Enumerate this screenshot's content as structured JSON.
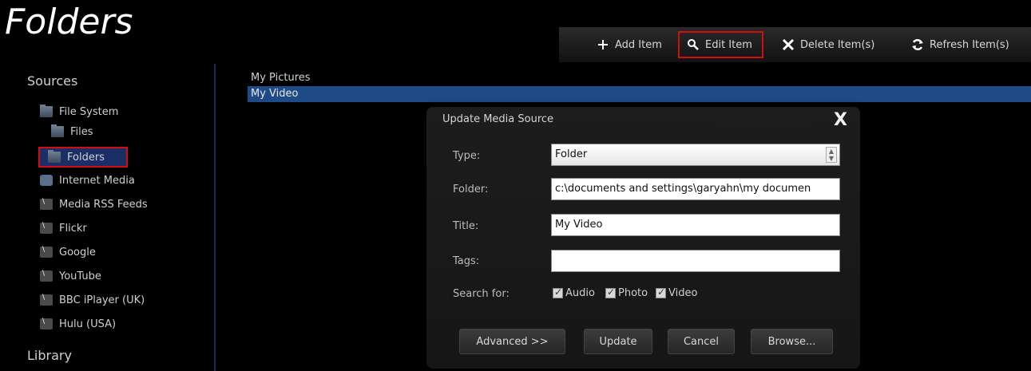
{
  "app": {
    "title": "Folders"
  },
  "toolbar": {
    "add_label": "Add Item",
    "edit_label": "Edit Item",
    "delete_label": "Delete Item(s)",
    "refresh_label": "Refresh Item(s)"
  },
  "sidebar": {
    "sources_heading": "Sources",
    "library_heading": "Library",
    "items": [
      {
        "label": "File System",
        "icon": "folder-icon"
      },
      {
        "label": "Files",
        "icon": "folder-icon"
      },
      {
        "label": "Folders",
        "icon": "folder-icon",
        "selected": true
      },
      {
        "label": "Internet Media",
        "icon": "internet-icon"
      },
      {
        "label": "Media RSS Feeds",
        "icon": "rss-icon"
      },
      {
        "label": "Flickr",
        "icon": "rss-icon"
      },
      {
        "label": "Google",
        "icon": "rss-icon"
      },
      {
        "label": "YouTube",
        "icon": "rss-icon"
      },
      {
        "label": "BBC iPlayer (UK)",
        "icon": "rss-icon"
      },
      {
        "label": "Hulu (USA)",
        "icon": "rss-icon"
      }
    ]
  },
  "list": {
    "rows": [
      {
        "label": "My Pictures"
      },
      {
        "label": "My Video",
        "selected": true
      }
    ]
  },
  "dialog": {
    "title": "Update Media Source",
    "close_label": "X",
    "type_label": "Type:",
    "type_value": "Folder",
    "folder_label": "Folder:",
    "folder_value": "c:\\documents and settings\\garyahn\\my documen",
    "title_label": "Title:",
    "title_value": "My Video",
    "tags_label": "Tags:",
    "tags_value": "",
    "search_label": "Search for:",
    "search_options": [
      "Audio",
      "Photo",
      "Video"
    ],
    "buttons": {
      "advanced": "Advanced >>",
      "update": "Update",
      "cancel": "Cancel",
      "browse": "Browse..."
    }
  },
  "colors": {
    "accent": "#1e4a86",
    "highlight_border": "#d01010"
  }
}
